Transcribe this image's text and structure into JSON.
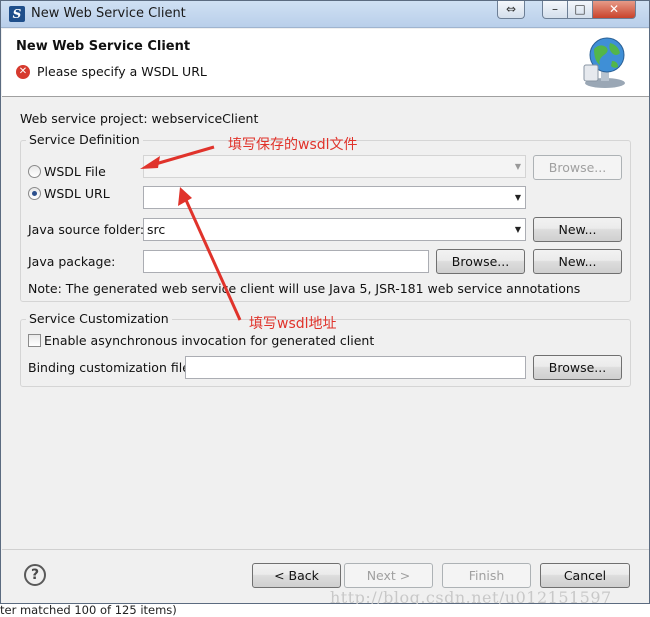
{
  "window": {
    "title": "New Web Service Client"
  },
  "header": {
    "title": "New Web Service Client",
    "message": "Please specify a WSDL URL",
    "error_icon_glyph": "✕"
  },
  "project": {
    "label": "Web service project: webserviceClient"
  },
  "service_definition": {
    "legend": "Service Definition",
    "wsdl_file_label": "WSDL File",
    "wsdl_file_value": "",
    "wsdl_file_browse": "Browse...",
    "wsdl_url_label": "WSDL URL",
    "wsdl_url_value": "",
    "wsdl_url_selected": true,
    "java_source_label": "Java source folder:",
    "java_source_value": "src",
    "java_source_new": "New...",
    "java_package_label": "Java package:",
    "java_package_value": "",
    "java_package_browse": "Browse...",
    "java_package_new": "New...",
    "note": "Note: The generated web service client will use Java 5, JSR-181 web service annotations"
  },
  "service_customization": {
    "legend": "Service Customization",
    "async_label": "Enable asynchronous invocation for generated client",
    "async_checked": false,
    "binding_label": "Binding customization file:",
    "binding_value": "",
    "binding_browse": "Browse..."
  },
  "footer": {
    "help_glyph": "?",
    "back": "< Back",
    "next": "Next >",
    "finish": "Finish",
    "cancel": "Cancel"
  },
  "annotations": {
    "wsdl_file_note": "填写保存的wsdl文件",
    "wsdl_url_note": "填写wsdl地址",
    "color": "#e0332b"
  },
  "watermark": "http://blog.csdn.net/u012151597",
  "status_bar": "ter matched 100 of 125 items)"
}
